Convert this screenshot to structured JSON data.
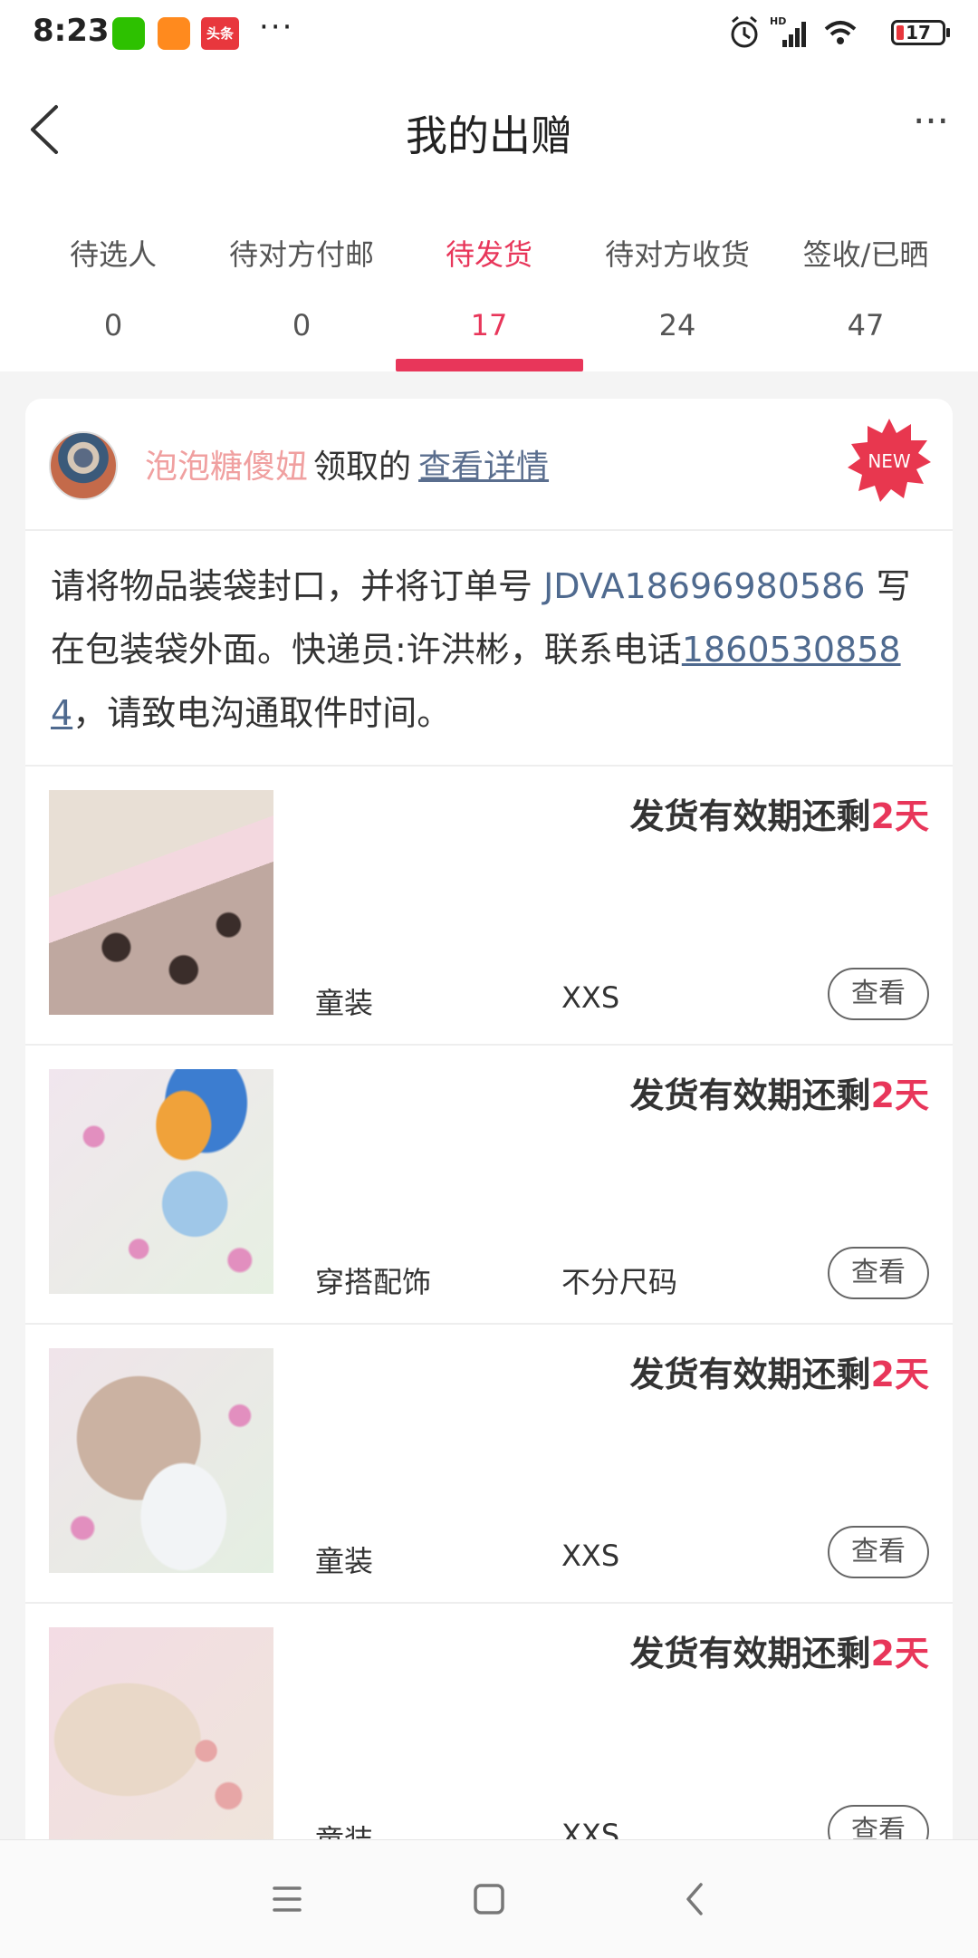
{
  "status_bar": {
    "time": "8:23",
    "toutiao_label": "头条",
    "more_dots": "···",
    "battery_level": "17",
    "signal_label": "HD"
  },
  "header": {
    "title": "我的出赠",
    "more_label": "···"
  },
  "tabs": [
    {
      "label": "待选人",
      "count": "0"
    },
    {
      "label": "待对方付邮",
      "count": "0"
    },
    {
      "label": "待发货",
      "count": "17",
      "active": true
    },
    {
      "label": "待对方收货",
      "count": "24"
    },
    {
      "label": "签收/已晒",
      "count": "47"
    }
  ],
  "card": {
    "username": "泡泡糖傻妞",
    "claimed_text": "领取的",
    "details_link": "查看详情",
    "new_badge": "NEW",
    "notice_prefix": "请将物品装袋封口，并将订单号 ",
    "order_number": "JDVA18696980586",
    "notice_middle": " 写在包装袋外面。快递员:许洪彬，联系电话",
    "phone": "18605308584",
    "notice_suffix": "，请致电沟通取件时间。"
  },
  "items": [
    {
      "deadline_prefix": "发货有效期还剩",
      "days": "2天",
      "category": "童装",
      "size": "XXS",
      "view_label": "查看"
    },
    {
      "deadline_prefix": "发货有效期还剩",
      "days": "2天",
      "category": "穿搭配饰",
      "size": "不分尺码",
      "view_label": "查看"
    },
    {
      "deadline_prefix": "发货有效期还剩",
      "days": "2天",
      "category": "童装",
      "size": "XXS",
      "view_label": "查看"
    },
    {
      "deadline_prefix": "发货有效期还剩",
      "days": "2天",
      "category": "童装",
      "size": "XXS",
      "view_label": "查看"
    }
  ],
  "colors": {
    "accent": "#e8365a",
    "link": "#4f6a8f",
    "username": "#f0a0a0"
  }
}
